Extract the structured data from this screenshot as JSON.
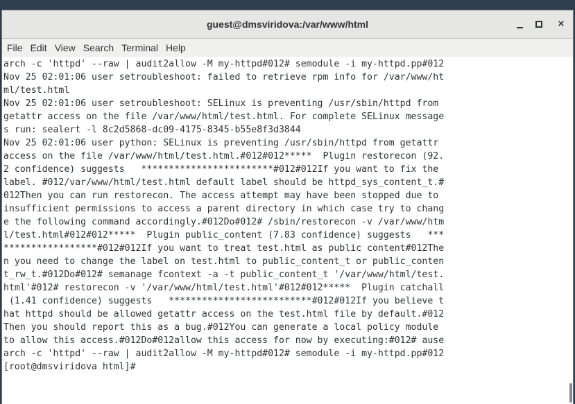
{
  "window": {
    "title": "guest@dmsviridova:/var/www/html",
    "close_glyph": "×"
  },
  "menu": {
    "file": "File",
    "edit": "Edit",
    "view": "View",
    "search": "Search",
    "terminal": "Terminal",
    "help": "Help"
  },
  "terminal": {
    "lines": [
      "arch -c 'httpd' --raw | audit2allow -M my-httpd#012# semodule -i my-httpd.pp#012",
      "Nov 25 02:01:06 user setroubleshoot: failed to retrieve rpm info for /var/www/ht",
      "ml/test.html",
      "Nov 25 02:01:06 user setroubleshoot: SELinux is preventing /usr/sbin/httpd from",
      "getattr access on the file /var/www/html/test.html. For complete SELinux message",
      "s run: sealert -l 8c2d5868-dc09-4175-8345-b55e8f3d3844",
      "Nov 25 02:01:06 user python: SELinux is preventing /usr/sbin/httpd from getattr",
      "access on the file /var/www/html/test.html.#012#012*****  Plugin restorecon (92.",
      "2 confidence) suggests   ************************#012#012If you want to fix the",
      "label. #012/var/www/html/test.html default label should be httpd_sys_content_t.#",
      "012Then you can run restorecon. The access attempt may have been stopped due to",
      "insufficient permissions to access a parent directory in which case try to chang",
      "e the following command accordingly.#012Do#012# /sbin/restorecon -v /var/www/htm",
      "l/test.html#012#012*****  Plugin public_content (7.83 confidence) suggests   ***",
      "*****************#012#012If you want to treat test.html as public content#012The",
      "n you need to change the label on test.html to public_content_t or public_conten",
      "t_rw_t.#012Do#012# semanage fcontext -a -t public_content_t '/var/www/html/test.",
      "html'#012# restorecon -v '/var/www/html/test.html'#012#012*****  Plugin catchall",
      " (1.41 confidence) suggests   **************************#012#012If you believe t",
      "hat httpd should be allowed getattr access on the test.html file by default.#012",
      "Then you should report this as a bug.#012You can generate a local policy module",
      "to allow this access.#012Do#012allow this access for now by executing:#012# ause",
      "arch -c 'httpd' --raw | audit2allow -M my-httpd#012# semodule -i my-httpd.pp#012",
      "[root@dmsviridova html]# "
    ]
  }
}
